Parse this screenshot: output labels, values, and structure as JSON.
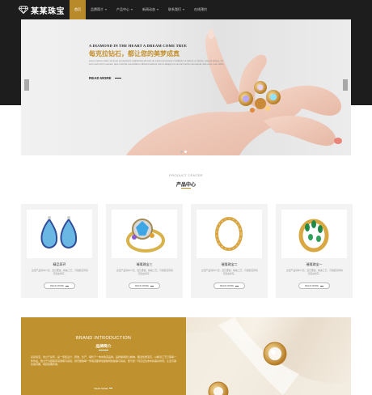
{
  "header": {
    "logo_text": "某某珠宝",
    "nav": [
      {
        "label": "首页",
        "active": true,
        "caret": false
      },
      {
        "label": "品牌简介",
        "active": false,
        "caret": true
      },
      {
        "label": "产品中心",
        "active": false,
        "caret": true
      },
      {
        "label": "新闻动态",
        "active": false,
        "caret": true
      },
      {
        "label": "联系我们",
        "active": false,
        "caret": true
      },
      {
        "label": "在线预约",
        "active": false,
        "caret": false
      }
    ]
  },
  "hero": {
    "kicker": "A DIAMOND IN THE HEART A DREAM COME TRUE",
    "title": "每克拉钻石，都让您的美梦成真",
    "desc": "Lorem ipsum dolor sit amet consectetur adipiscing elit sed do eiusmod tempor incididunt ut labore et dolore magna aliqua. Ut enim ad minim veniam quis nostrud exercitation ullamco laboris nisi ut aliquip ex ea commodo consequat duis aute irure dolor.",
    "more_label": "READ MORE",
    "slides_count": 2,
    "active_slide": 2
  },
  "products": {
    "en_title": "PRODUCT CENTER",
    "cn_title": "产品中心",
    "items": [
      {
        "name": "精品耳环",
        "desc": "这里产品简单介绍，宝石镶嵌，精美工艺，可根据实际情况自由填写。",
        "btn": "READ MORE"
      },
      {
        "name": "璀璨珠宝三",
        "desc": "这里产品简单介绍，宝石镶嵌，精美工艺，可根据实际情况自由填写。",
        "btn": "READ MORE"
      },
      {
        "name": "璀璨珠宝二",
        "desc": "这里产品简单介绍，宝石镶嵌，精美工艺，可根据实际情况自由填写。",
        "btn": "READ MORE"
      },
      {
        "name": "璀璨珠宝一",
        "desc": "这里产品简单介绍，宝石镶嵌，精美工艺，可根据实际情况自由填写。",
        "btn": "READ MORE"
      }
    ]
  },
  "brand": {
    "en_title": "BRAND INTRODUCTION",
    "cn_title": "品牌简介",
    "desc": "某某珠宝，创立于某年，是一家集设计、研发、生产、销售于一体的珠宝品牌。品牌秉承匠心精神，甄选优质宝石，以精湛工艺打造每一件作品，致力于为顾客带来璀璨与感动。我们相信每一件珠宝都承载着独特的故事与情感，愿与您一同见证生命中的美好时刻，让爱与美永恒闪耀，成就经典传承。",
    "more_label": "READ MORE"
  },
  "colors": {
    "accent": "#c0922f",
    "header_bg": "#1d1d1d",
    "nav_active_bg": "#b98a2a"
  }
}
